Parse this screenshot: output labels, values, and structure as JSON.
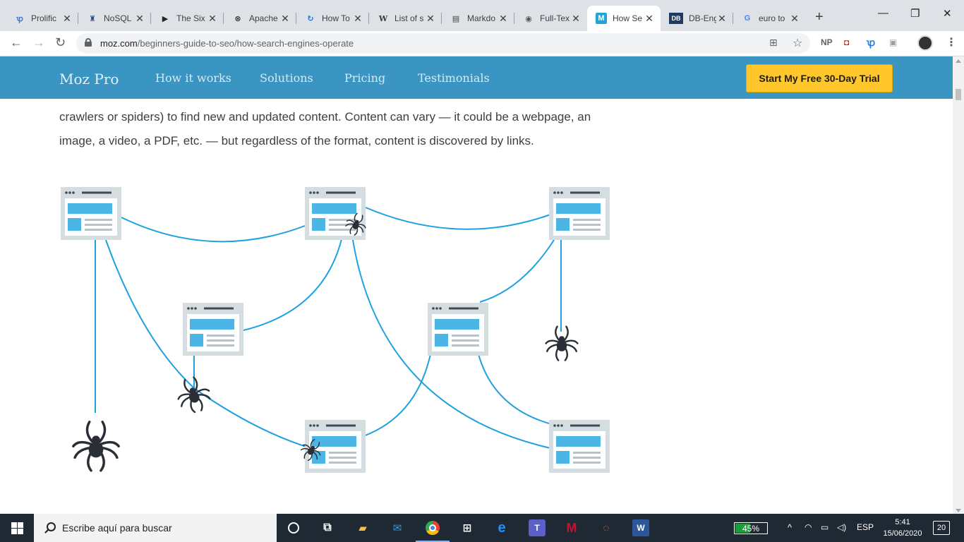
{
  "browser": {
    "tabs": [
      {
        "title": "Prolific",
        "icon": "prolific-icon",
        "color": "#2c7de0"
      },
      {
        "title": "NoSQL",
        "icon": "nosql-icon",
        "color": "#2b4c7e"
      },
      {
        "title": "The Six",
        "icon": "flag-icon",
        "color": "#222222"
      },
      {
        "title": "Apache",
        "icon": "circle-x-icon",
        "color": "#333333"
      },
      {
        "title": "How To",
        "icon": "refresh-icon",
        "color": "#1a73e8"
      },
      {
        "title": "List of s",
        "icon": "wikipedia-icon",
        "color": "#111111"
      },
      {
        "title": "Markdo",
        "icon": "doc-icon",
        "color": "#333333"
      },
      {
        "title": "Full-Tex",
        "icon": "globe-icon",
        "color": "#555555"
      },
      {
        "title": "How Se",
        "icon": "moz-icon",
        "color": "#1ea6d8"
      },
      {
        "title": "DB-Eng",
        "icon": "db-engines-icon",
        "color": "#1d3b63"
      },
      {
        "title": "euro to",
        "icon": "google-icon",
        "color": "#4285f4"
      }
    ],
    "url_host": "moz.com",
    "url_path": "/beginners-guide-to-seo/how-search-engines-operate",
    "extensions": [
      "NP"
    ]
  },
  "moz": {
    "logo": "Moz Pro",
    "nav": [
      "How it works",
      "Solutions",
      "Pricing",
      "Testimonials"
    ],
    "cta": "Start My Free 30-Day Trial",
    "brand_color": "#3b95c2",
    "cta_color": "#ffc72c"
  },
  "article": {
    "line1": "crawlers or spiders) to find new and updated content. Content can vary — it could be a webpage, an",
    "line2": "image, a video, a PDF, etc. — but regardless of the format, content is discovered by links."
  },
  "taskbar": {
    "search_placeholder": "Escribe aquí para buscar",
    "battery": "45%",
    "battery_level": 0.45,
    "language": "ESP",
    "time": "5:41",
    "date": "15/06/2020",
    "notifications": "20",
    "apps": [
      "cortana-icon",
      "task-view-icon",
      "file-explorer-icon",
      "mail-icon",
      "chrome-icon",
      "store-icon",
      "edge-icon",
      "teams-icon",
      "mcafee-icon",
      "jupyter-icon",
      "word-icon"
    ]
  }
}
